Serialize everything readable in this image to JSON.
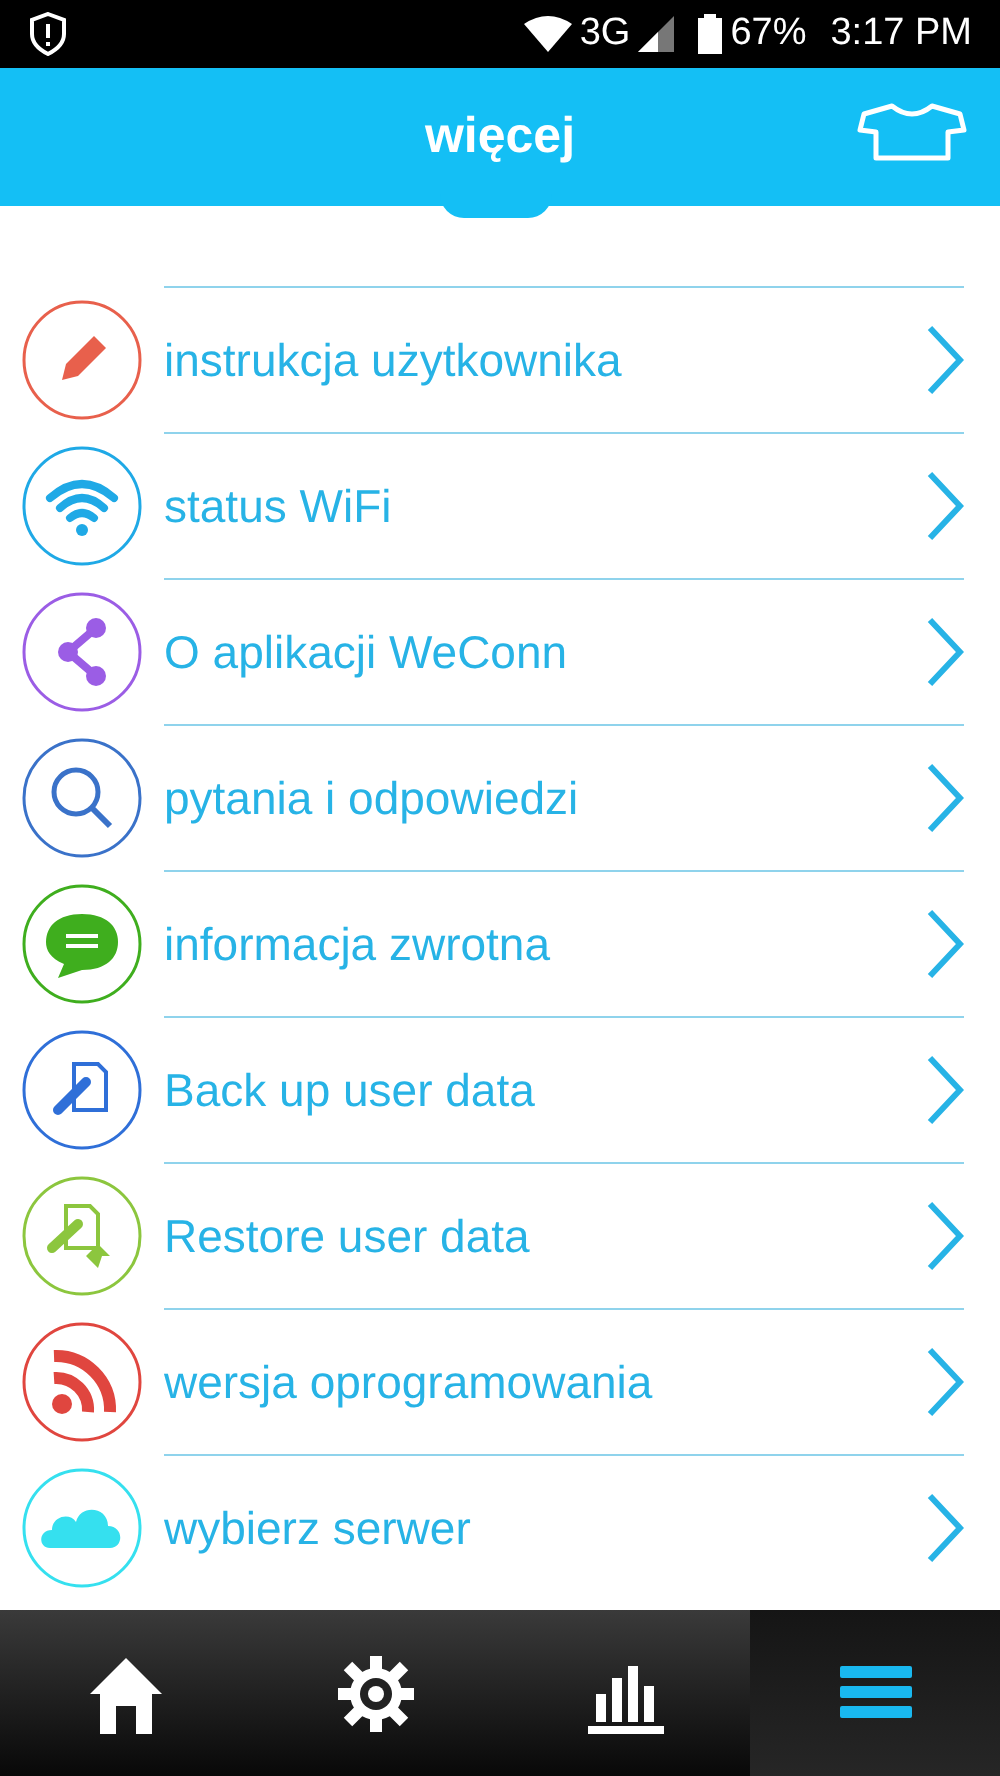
{
  "status_bar": {
    "network": "3G",
    "battery": "67%",
    "time": "3:17 PM"
  },
  "header": {
    "title": "więcej"
  },
  "menu_items": [
    {
      "label": "instrukcja użytkownika",
      "kind": "pencil",
      "color": "#e8604c"
    },
    {
      "label": "status WiFi",
      "kind": "wifi",
      "color": "#1fa9e6"
    },
    {
      "label": "O aplikacji WeConn",
      "kind": "share",
      "color": "#9b5de5"
    },
    {
      "label": "pytania i odpowiedzi",
      "kind": "search",
      "color": "#3a72c9"
    },
    {
      "label": "informacja zwrotna",
      "kind": "chat",
      "color": "#3fae1e"
    },
    {
      "label": "Back up user data",
      "kind": "backup",
      "color": "#2f6fd8"
    },
    {
      "label": "Restore user data",
      "kind": "restore",
      "color": "#8cc63e"
    },
    {
      "label": "wersja oprogramowania",
      "kind": "rss",
      "color": "#e0463f"
    },
    {
      "label": "wybierz serwer",
      "kind": "cloud",
      "color": "#35e0ef"
    }
  ],
  "tab_bar": [
    {
      "kind": "home",
      "selected": false
    },
    {
      "kind": "settings",
      "selected": false
    },
    {
      "kind": "chart",
      "selected": false
    },
    {
      "kind": "menu",
      "selected": true
    }
  ]
}
